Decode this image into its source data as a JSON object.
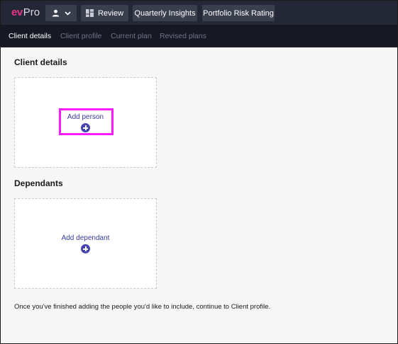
{
  "app": {
    "logo_ev": "ev",
    "logo_pro": "Pro"
  },
  "toolbar": {
    "user_menu_icon": "person-icon",
    "user_menu_caret": "chevron-down-icon",
    "review_icon": "dashboard-icon",
    "review_label": "Review",
    "quarterly_label": "Quarterly Insights",
    "portfolio_label": "Portfolio Risk Rating"
  },
  "tabs": [
    {
      "label": "Client details",
      "active": true
    },
    {
      "label": "Client profile",
      "active": false
    },
    {
      "label": "Current plan",
      "active": false
    },
    {
      "label": "Revised plans",
      "active": false
    }
  ],
  "sections": {
    "client_details": {
      "title": "Client details",
      "add_label": "Add person",
      "add_icon": "plus-circle-icon"
    },
    "dependants": {
      "title": "Dependants",
      "add_label": "Add dependant",
      "add_icon": "plus-circle-icon"
    }
  },
  "footer_note": "Once you've finished adding the people you'd like to include, continue to Client profile.",
  "colors": {
    "topbar_bg": "#242836",
    "subnav_bg": "#161924",
    "button_bg": "#3a3f4e",
    "accent_pink": "#e6338a",
    "link_purple": "#3b3a9e",
    "highlight_magenta": "#ff19ff"
  }
}
